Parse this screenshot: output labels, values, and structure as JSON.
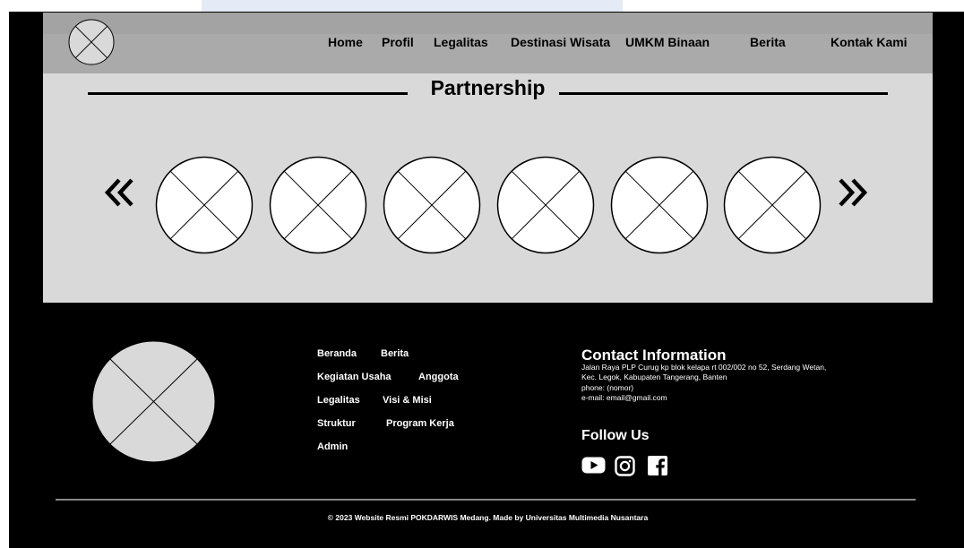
{
  "nav": {
    "items": [
      {
        "label": "Home"
      },
      {
        "label": "Profil"
      },
      {
        "label": "Legalitas"
      },
      {
        "label": "Destinasi Wisata"
      },
      {
        "label": "UMKM Binaan"
      },
      {
        "label": "Berita"
      },
      {
        "label": "Kontak Kami"
      }
    ]
  },
  "partnership": {
    "title": "Partnership",
    "partners_count": 6,
    "prev_icon": "double-chevron-left-icon",
    "next_icon": "double-chevron-right-icon"
  },
  "footer": {
    "links": [
      {
        "label": "Beranda"
      },
      {
        "label": "Berita"
      },
      {
        "label": "Kegiatan Usaha"
      },
      {
        "label": "Anggota"
      },
      {
        "label": "Legalitas"
      },
      {
        "label": "Visi & Misi"
      },
      {
        "label": "Struktur"
      },
      {
        "label": "Program Kerja"
      },
      {
        "label": "Admin"
      }
    ],
    "contact": {
      "title": "Contact Information",
      "address_line1": "Jalan Raya PLP Curug kp blok kelapa rt 002/002 no 52, Serdang Wetan,",
      "address_line2": "Kec. Legok, Kabupaten Tangerang, Banten",
      "phone": "phone: (nomor)",
      "email": "e-mail: email@gmail.com"
    },
    "follow_title": "Follow Us",
    "social_icons": [
      "youtube-icon",
      "instagram-icon",
      "facebook-icon"
    ],
    "copyright": "© 2023 Website Resmi POKDARWIS Medang. Made by Universitas Multimedia Nusantara"
  },
  "colors": {
    "header_bg": "#aaaaaa",
    "partner_bg": "#d9d9d9",
    "footer_bg": "#000000",
    "footer_text": "#ffffff"
  }
}
